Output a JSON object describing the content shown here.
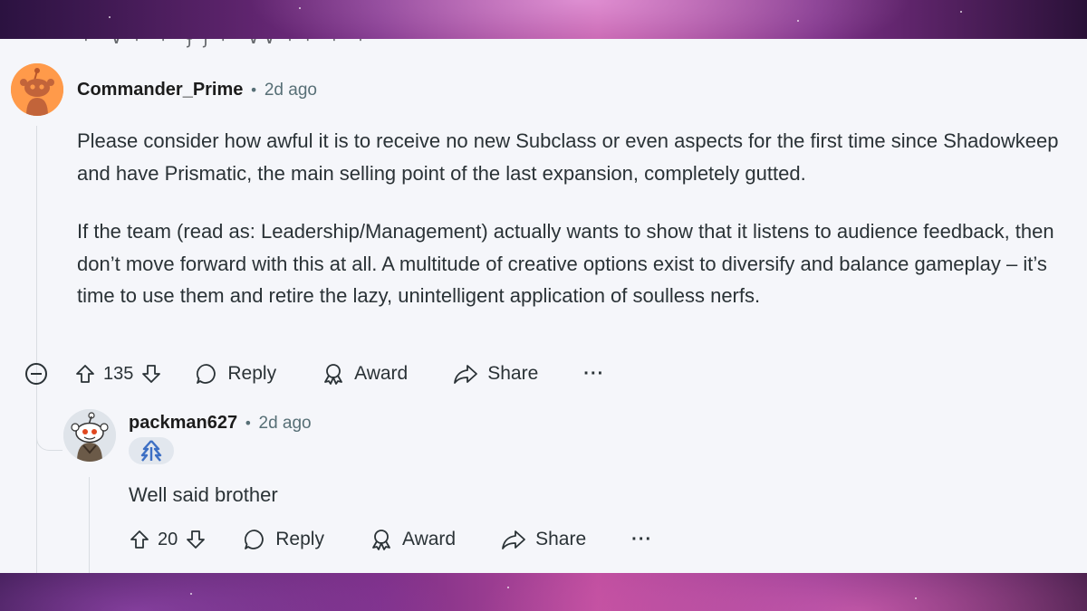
{
  "comment": {
    "author": "Commander_Prime",
    "time": "2d ago",
    "paragraphs": [
      "Please consider how awful it is to receive no new Subclass or even aspects for the first time since Shadowkeep and have Prismatic, the main selling point of the last expansion, completely gutted.",
      "If the team (read as: Leadership/Management) actually wants to show that it listens to audience feedback, then don’t move forward with this at all. A multitude of creative options exist to diversify and balance gameplay – it’s time to use them and retire the lazy, unintelligent application of soulless nerfs."
    ],
    "actions": {
      "votes": "135",
      "reply": "Reply",
      "award": "Award",
      "share": "Share",
      "more": "···"
    }
  },
  "reply": {
    "author": "packman627",
    "time": "2d ago",
    "flair_icon": "destiny-hunter-icon",
    "text": "Well said brother",
    "actions": {
      "votes": "20",
      "reply": "Reply",
      "award": "Award",
      "share": "Share",
      "more": "···"
    }
  },
  "colors": {
    "panel_bg": "#f5f6fa",
    "text": "#2a3236",
    "meta": "#576f76",
    "avatar_orange": "#ff9a4a"
  }
}
